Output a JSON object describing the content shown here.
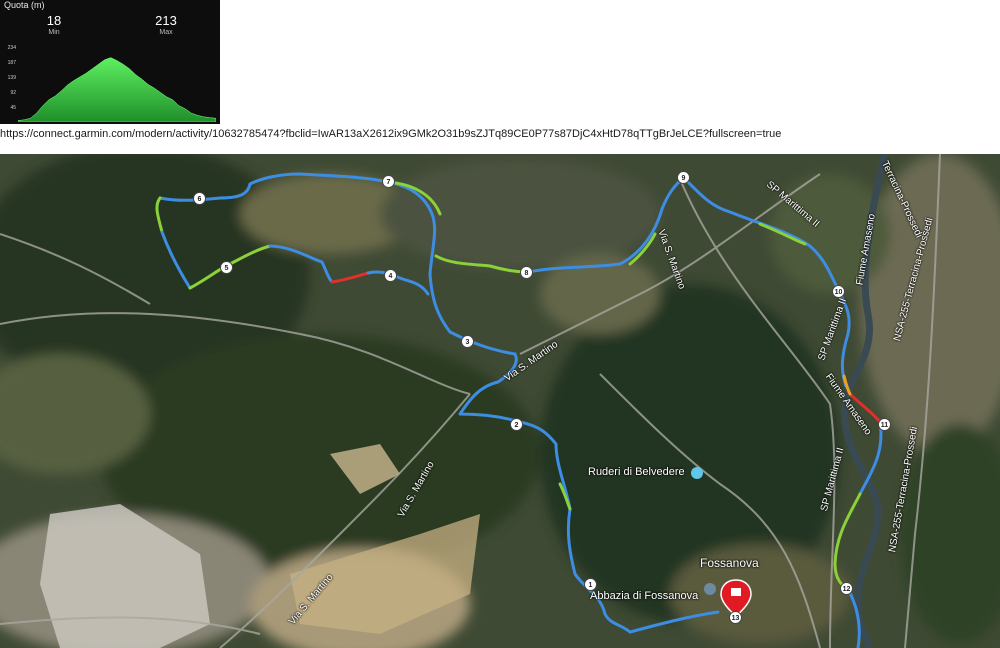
{
  "elevation": {
    "title": "Quota (m)",
    "min_value": "18",
    "min_label": "Min",
    "max_value": "213",
    "max_label": "Max",
    "y_ticks": [
      "234",
      "187",
      "139",
      "92",
      "45"
    ],
    "fill_color": "#3cd94a",
    "profile": [
      0.02,
      0.03,
      0.05,
      0.12,
      0.22,
      0.3,
      0.35,
      0.42,
      0.5,
      0.56,
      0.61,
      0.66,
      0.72,
      0.78,
      0.84,
      0.87,
      0.83,
      0.78,
      0.72,
      0.64,
      0.58,
      0.51,
      0.46,
      0.4,
      0.34,
      0.3,
      0.22,
      0.18,
      0.12,
      0.09,
      0.07,
      0.06,
      0.05
    ]
  },
  "url": "https://connect.garmin.com/modern/activity/10632785474?fbclid=IwAR13aX2612ix9GMk2O31b9sZJTq89CE0P77s87DjC4xHtD78qTTgBrJeLCE?fullscreen=true",
  "map": {
    "waypoints": [
      "1",
      "2",
      "3",
      "4",
      "5",
      "6",
      "7",
      "8",
      "9",
      "10",
      "11",
      "12",
      "13"
    ],
    "road_labels": {
      "via_s_martino_1": "Via S. Martino",
      "via_s_martino_2": "Via S. Martino",
      "via_s_martino_3": "Via S. Martino",
      "via_s_martino_4": "Via S. Martino",
      "sp_marittima_1": "SP Marittima II",
      "sp_marittima_2": "SP Marittima II",
      "sp_marittima_3": "SP Marittima II",
      "fiume_amaseno_1": "Fiume Amaseno",
      "fiume_amaseno_2": "Fiume Amaseno",
      "ss_1": "Terracina-Prossedi",
      "ss_2": "NSA-255-Terracina-Prossedi",
      "ss_3": "NSA-255-Terracina-Prossedi"
    },
    "poi_ruderi": "Ruderi di Belvedere",
    "poi_abbazia": "Abbazia di Fossanova",
    "town": "Fossanova",
    "route_colors": {
      "blue": "#3d8de3",
      "green": "#8bd13a",
      "red": "#e0302a",
      "orange": "#f0a020"
    },
    "marker_color": "#e01b24"
  }
}
